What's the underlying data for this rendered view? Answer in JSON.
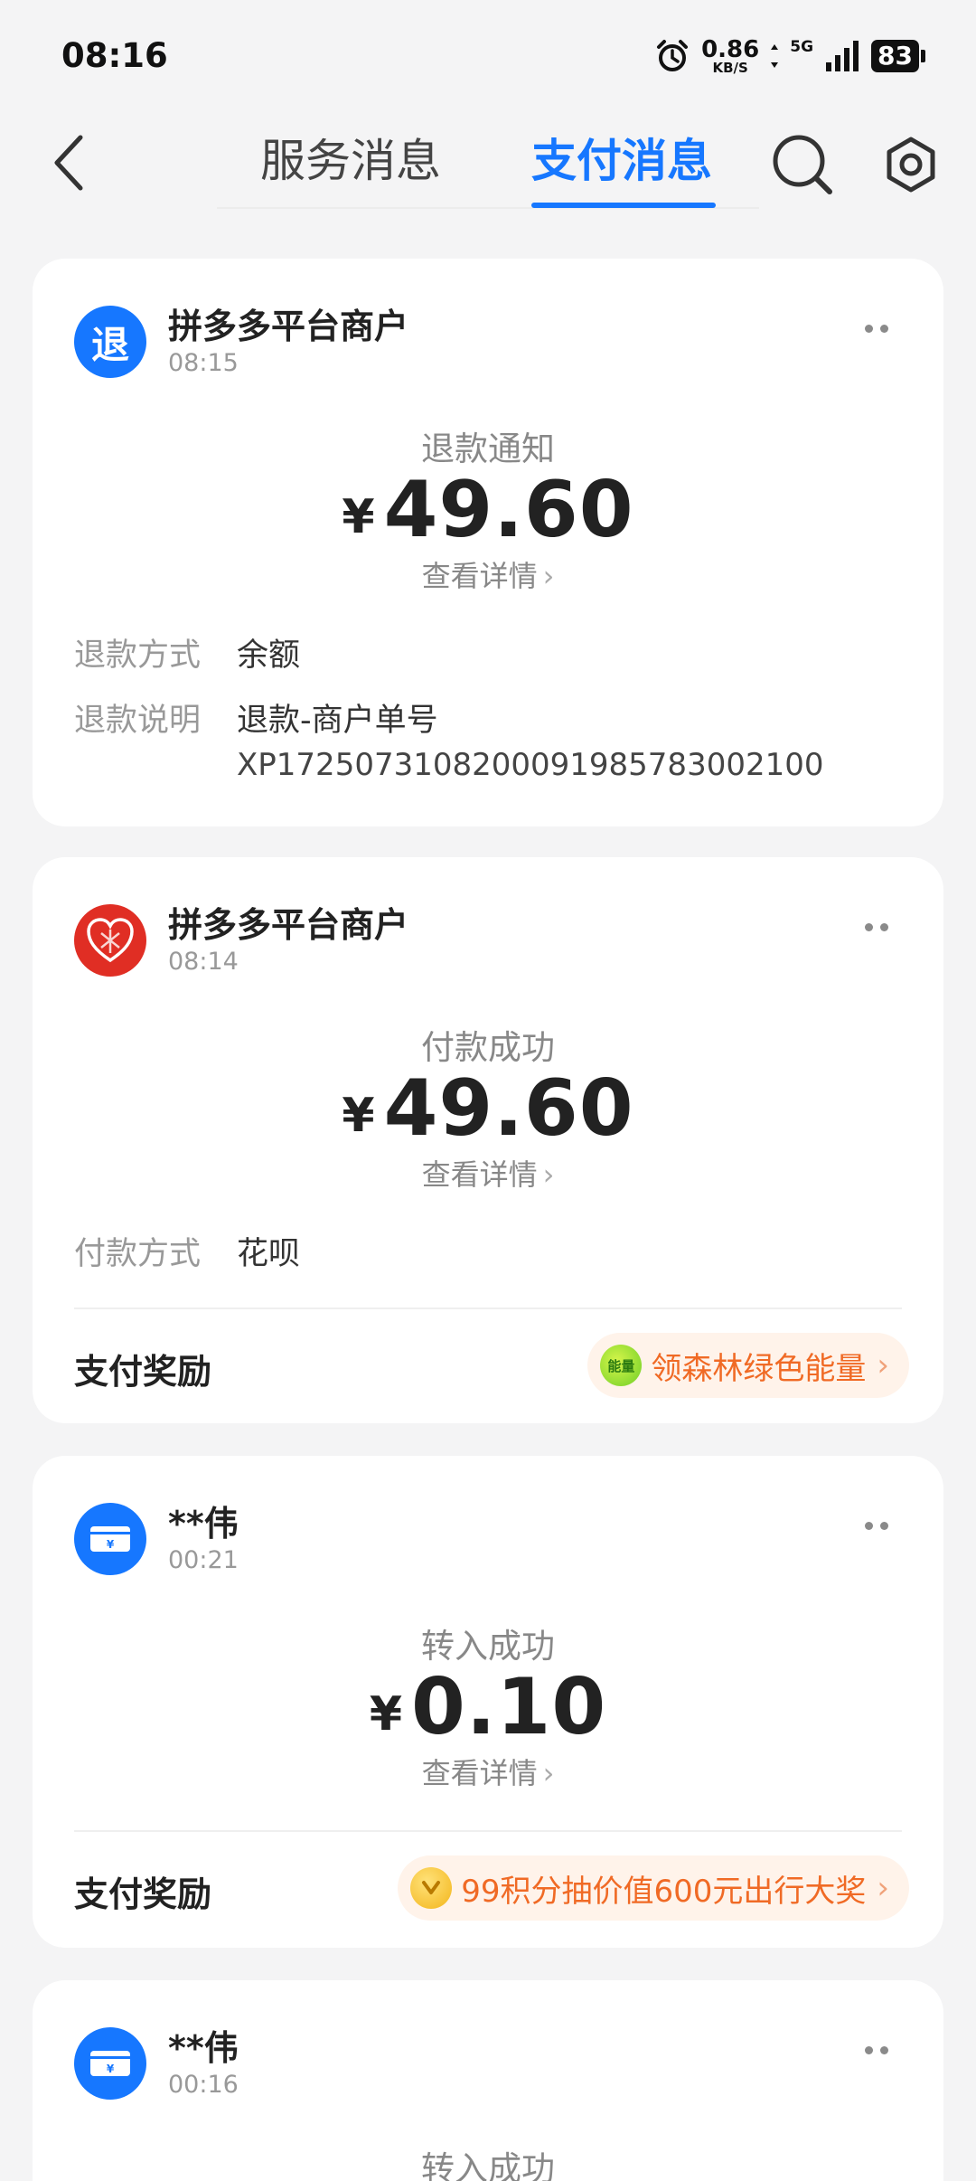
{
  "status_bar": {
    "time": "08:16",
    "speed_value": "0.86",
    "speed_unit": "KB/S",
    "network": "5G",
    "battery": "83"
  },
  "header": {
    "tabs": [
      {
        "label": "服务消息",
        "active": false
      },
      {
        "label": "支付消息",
        "active": true
      }
    ]
  },
  "messages": [
    {
      "avatar_text": "退",
      "merchant": "拼多多平台商户",
      "time": "08:15",
      "title": "退款通知",
      "currency": "¥",
      "amount": "49.60",
      "detail_link": "查看详情",
      "rows": [
        {
          "label": "退款方式",
          "value": "余额"
        },
        {
          "label": "退款说明",
          "value": "退款-商户单号",
          "value2": "XP1725073108200091985783002100"
        }
      ]
    },
    {
      "avatar_text": "拼",
      "merchant": "拼多多平台商户",
      "time": "08:14",
      "title": "付款成功",
      "currency": "¥",
      "amount": "49.60",
      "detail_link": "查看详情",
      "rows": [
        {
          "label": "付款方式",
          "value": "花呗"
        }
      ],
      "reward_label": "支付奖励",
      "reward_icon_text": "能量",
      "reward_text": "领森林绿色能量"
    },
    {
      "merchant": "**伟",
      "time": "00:21",
      "title": "转入成功",
      "currency": "¥",
      "amount": "0.10",
      "detail_link": "查看详情",
      "reward_label": "支付奖励",
      "reward_text": "99积分抽价值600元出行大奖"
    },
    {
      "merchant": "**伟",
      "time": "00:16",
      "title": "转入成功"
    }
  ],
  "colors": {
    "accent": "#1677ff",
    "reward_text": "#f06a25",
    "pdd_red": "#e02e24"
  }
}
